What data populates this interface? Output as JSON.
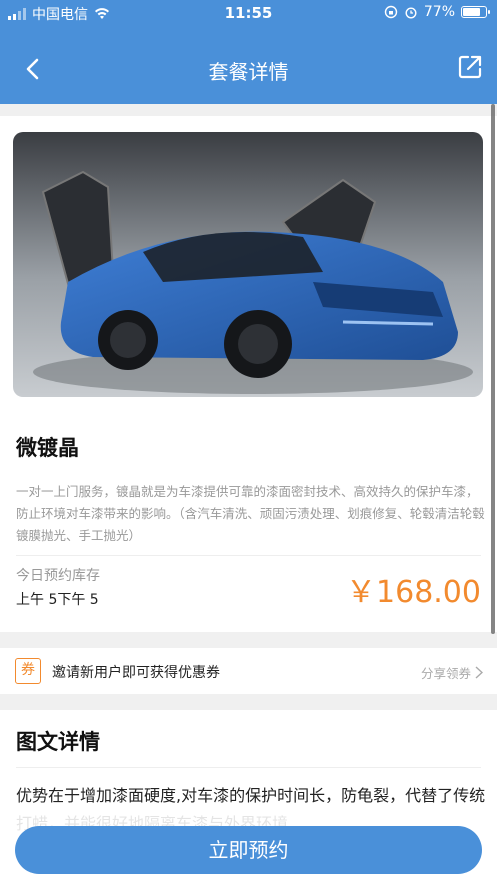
{
  "status_bar": {
    "carrier": "中国电信",
    "time": "11:55",
    "battery_percent": "77%",
    "battery_level": 0.77
  },
  "nav": {
    "title": "套餐详情",
    "back_icon": "chevron-left-icon",
    "share_icon": "share-external-icon"
  },
  "product": {
    "name": "微镀晶",
    "description": "一对一上门服务，镀晶就是为车漆提供可靠的漆面密封技术、高效持久的保护车漆，防止环境对车漆带来的影响。（含汽车清洗、顽固污渍处理、划痕修复、轮毂清洁轮毂镀膜抛光、手工抛光）",
    "stock_label": "今日预约库存",
    "stock_value": "上午 5下午 5",
    "price": "￥168.00"
  },
  "coupon": {
    "icon_char": "券",
    "text": "邀请新用户即可获得优惠券",
    "link": "分享领券"
  },
  "detail": {
    "title": "图文详情",
    "body": "优势在于增加漆面硬度,对车漆的保护时间长，防龟裂，代替了传统打蜡，并能很好地隔离车漆与外界环境"
  },
  "action": {
    "book_label": "立即预约"
  },
  "colors": {
    "brand": "#4a90d9",
    "price": "#f28a2e"
  }
}
